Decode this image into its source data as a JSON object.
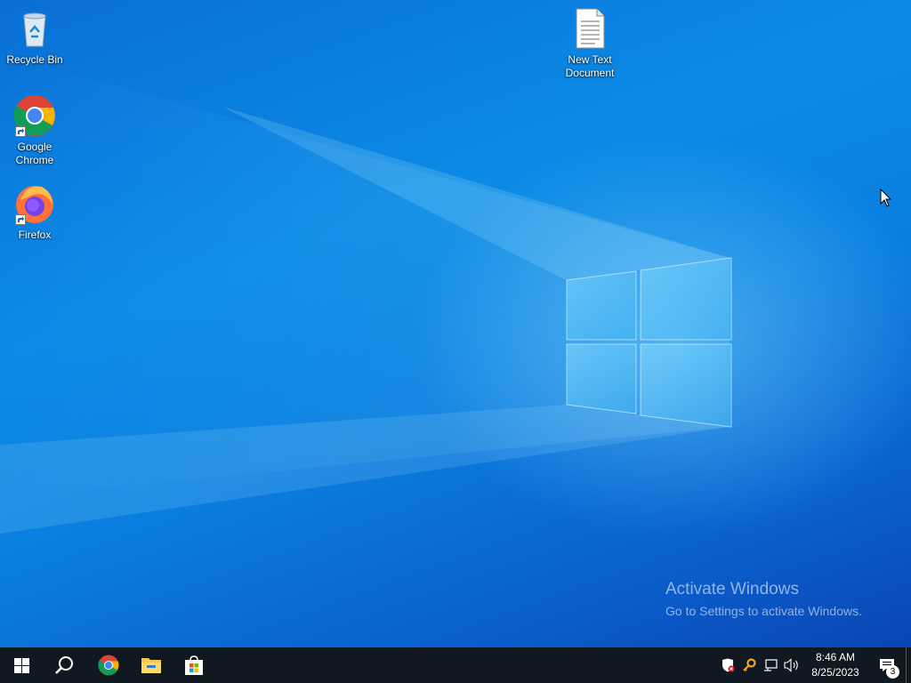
{
  "desktop": {
    "icons": [
      {
        "label": "Recycle Bin",
        "icon": "recycle-bin-icon"
      },
      {
        "label": "Google Chrome",
        "icon": "chrome-icon"
      },
      {
        "label": "Firefox",
        "icon": "firefox-icon"
      },
      {
        "label": "New Text Document",
        "icon": "text-document-icon"
      }
    ]
  },
  "watermark": {
    "title": "Activate Windows",
    "subtitle": "Go to Settings to activate Windows."
  },
  "taskbar": {
    "pinned": [
      {
        "icon": "windows-start-icon"
      },
      {
        "icon": "search-icon"
      },
      {
        "icon": "chrome-icon"
      },
      {
        "icon": "file-explorer-icon"
      },
      {
        "icon": "microsoft-store-icon"
      }
    ],
    "tray": {
      "icons": [
        "security-shield-icon",
        "key-icon",
        "network-icon",
        "volume-icon"
      ],
      "time": "8:46 AM",
      "date": "8/25/2023",
      "notification_count": "3"
    }
  },
  "colors": {
    "taskbar": "#101822",
    "desktop_accent": "#0a7fe0"
  }
}
